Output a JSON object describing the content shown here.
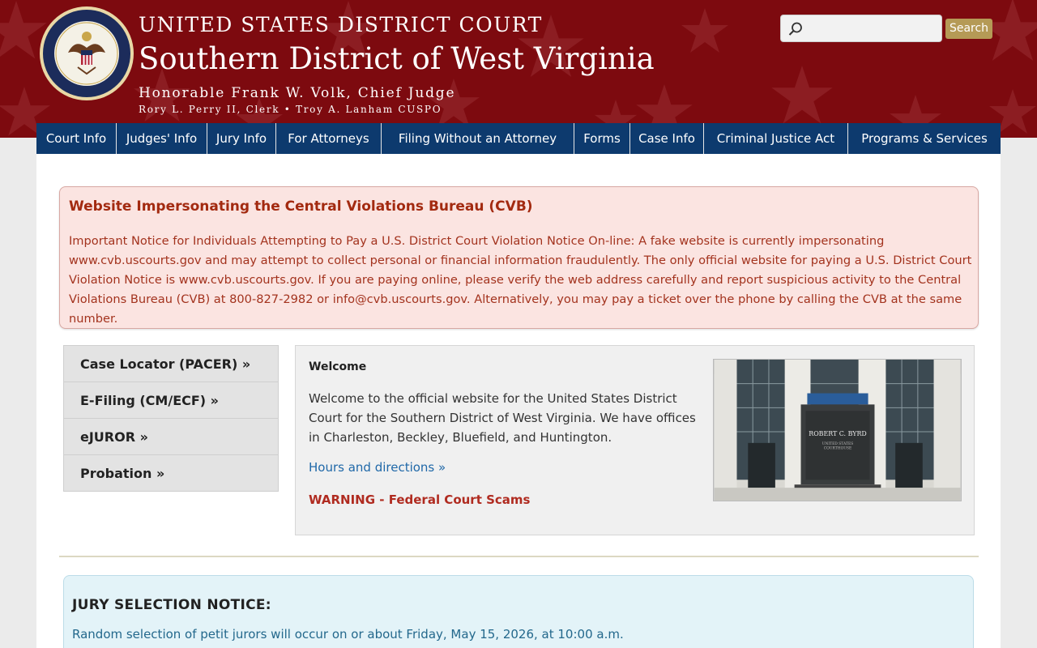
{
  "header": {
    "court": "UNITED STATES DISTRICT COURT",
    "district": "Southern District of West Virginia",
    "judge": "Honorable Frank W. Volk, Chief Judge",
    "clerks": "Rory L. Perry II, Clerk • Troy A. Lanham CUSPO",
    "seal_icon": "court-seal",
    "colors": {
      "banner": "#7d0a0f",
      "nav": "#0d3a6e",
      "search_button": "#b59a56"
    }
  },
  "search": {
    "placeholder": "",
    "value": "",
    "button_label": "Search",
    "icon": "search-icon"
  },
  "nav": {
    "items": [
      {
        "label": "Court Info"
      },
      {
        "label": "Judges' Info"
      },
      {
        "label": "Jury Info"
      },
      {
        "label": "For Attorneys"
      },
      {
        "label": "Filing Without an Attorney"
      },
      {
        "label": "Forms"
      },
      {
        "label": "Case Info"
      },
      {
        "label": "Criminal Justice Act"
      },
      {
        "label": "Programs & Services"
      }
    ]
  },
  "alert": {
    "title": "Website Impersonating the Central Violations Bureau (CVB)",
    "body": "Important Notice for Individuals Attempting to Pay a U.S. District Court Violation Notice On-line: A fake website is currently impersonating www.cvb.uscourts.gov and may attempt to collect personal or financial information fraudulently. The only official website for paying a U.S. District Court Violation Notice is www.cvb.uscourts.gov. If you are paying online, please verify the web address carefully and report suspicious activity to the Central Violations Bureau (CVB) at 800-827-2982 or info@cvb.uscourts.gov. Alternatively, you may pay a ticket over the phone by calling the CVB at the same number."
  },
  "sidebar": {
    "items": [
      {
        "label": "Case Locator (PACER) »"
      },
      {
        "label": "E-Filing (CM/ECF) »"
      },
      {
        "label": "eJUROR »"
      },
      {
        "label": "Probation »"
      }
    ]
  },
  "welcome": {
    "title": "Welcome",
    "text": "Welcome to the official website for the United States District Court for the Southern District of West Virginia. We have offices in Charleston, Beckley, Bluefield, and Huntington.",
    "hours_link": "Hours and directions »",
    "warning_link": "WARNING - Federal Court Scams",
    "photo": {
      "building_name": "ROBERT C. BYRD",
      "building_sub1": "UNITED STATES",
      "building_sub2": "COURTHOUSE"
    }
  },
  "jury": {
    "title": "JURY SELECTION NOTICE:",
    "text": "Random selection of petit jurors will occur on or about Friday, May 15, 2026, at 10:00 a.m."
  }
}
